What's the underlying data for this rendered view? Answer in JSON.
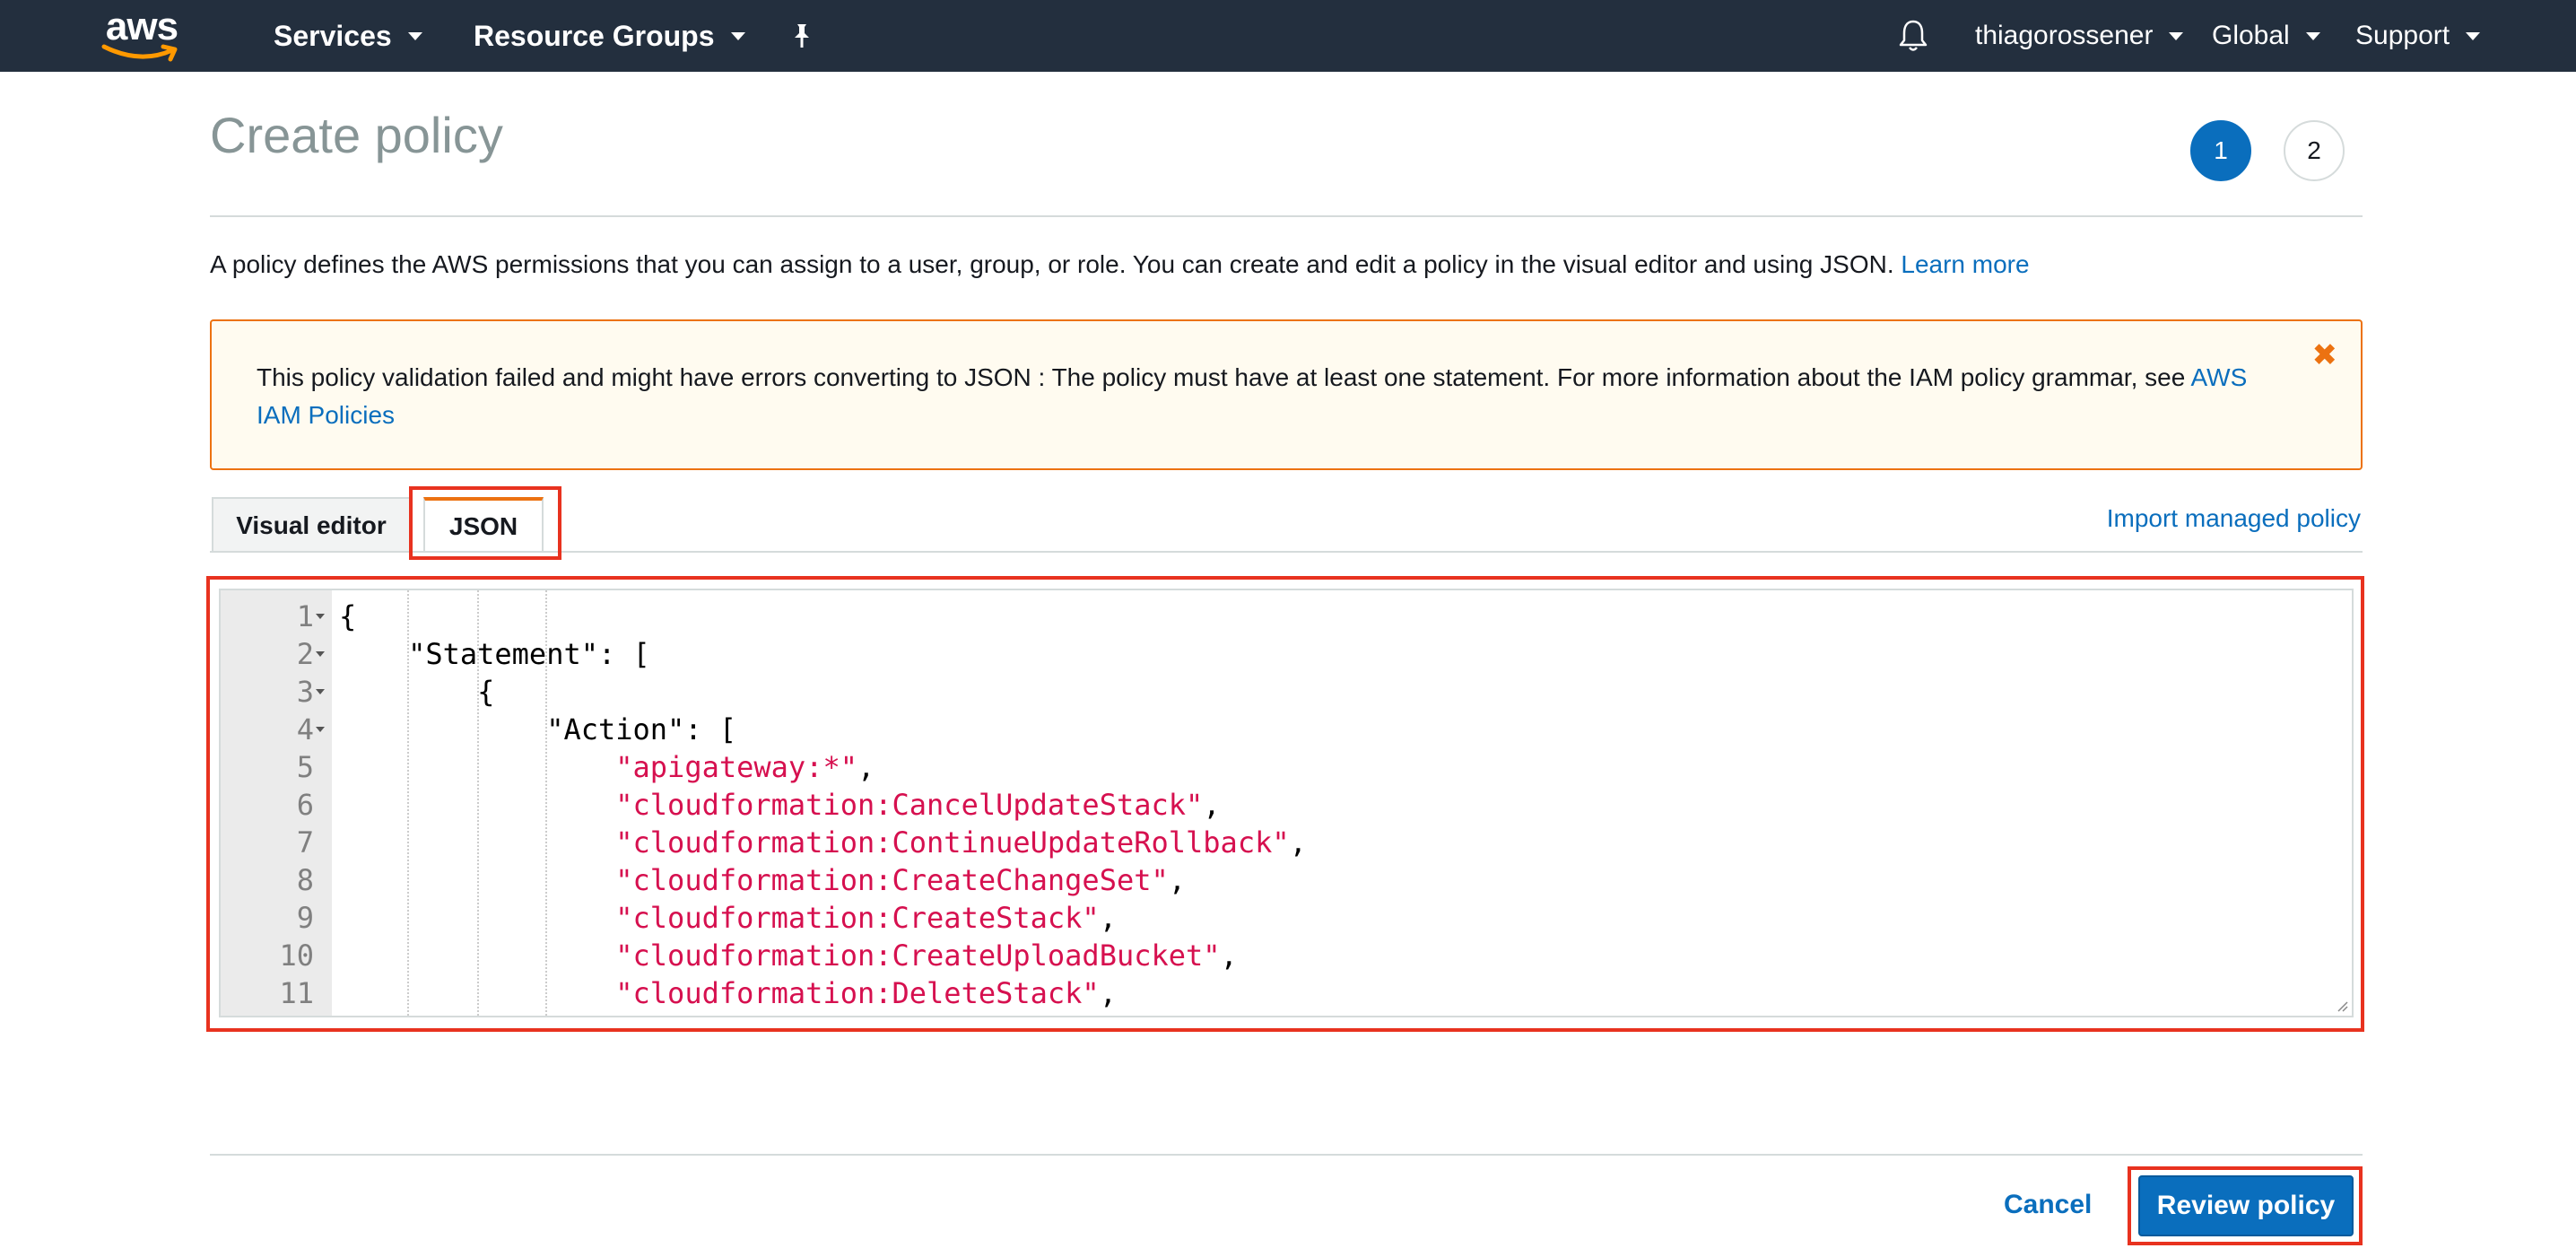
{
  "nav": {
    "logo_text": "aws",
    "services": "Services",
    "resource_groups": "Resource Groups",
    "pin_icon": "pushpin-icon",
    "bell_icon": "bell-icon",
    "account": "thiagorossener",
    "region": "Global",
    "support": "Support"
  },
  "page": {
    "title": "Create policy",
    "steps": [
      "1",
      "2"
    ],
    "active_step": "1",
    "description": "A policy defines the AWS permissions that you can assign to a user, group, or role. You can create and edit a policy in the visual editor and using JSON.",
    "learn_more": "Learn more"
  },
  "alert": {
    "message": "This policy validation failed and might have errors converting to JSON : The policy must have at least one statement. For more information about the IAM policy grammar, see",
    "link": "AWS IAM Policies",
    "close_icon": "close-icon"
  },
  "tabs": {
    "visual_editor": "Visual editor",
    "json": "JSON",
    "active": "JSON",
    "import_managed_policy": "Import managed policy"
  },
  "editor": {
    "lines": [
      {
        "n": "1",
        "text": "{"
      },
      {
        "n": "2",
        "text": "    \"Statement\": ["
      },
      {
        "n": "3",
        "text": "        {"
      },
      {
        "n": "4",
        "text": "            \"Action\": ["
      },
      {
        "n": "5",
        "text": "\"apigateway:*\""
      },
      {
        "n": "6",
        "text": "\"cloudformation:CancelUpdateStack\""
      },
      {
        "n": "7",
        "text": "\"cloudformation:ContinueUpdateRollback\""
      },
      {
        "n": "8",
        "text": "\"cloudformation:CreateChangeSet\""
      },
      {
        "n": "9",
        "text": "\"cloudformation:CreateStack\""
      },
      {
        "n": "10",
        "text": "\"cloudformation:CreateUploadBucket\""
      },
      {
        "n": "11",
        "text": "\"cloudformation:DeleteStack\""
      }
    ],
    "string_color": "#d6104f"
  },
  "footer": {
    "cancel": "Cancel",
    "review": "Review policy"
  },
  "colors": {
    "nav_bg": "#232f3e",
    "primary": "#0a6ebd",
    "warning_border": "#ec7211",
    "highlight": "#e8321f"
  }
}
